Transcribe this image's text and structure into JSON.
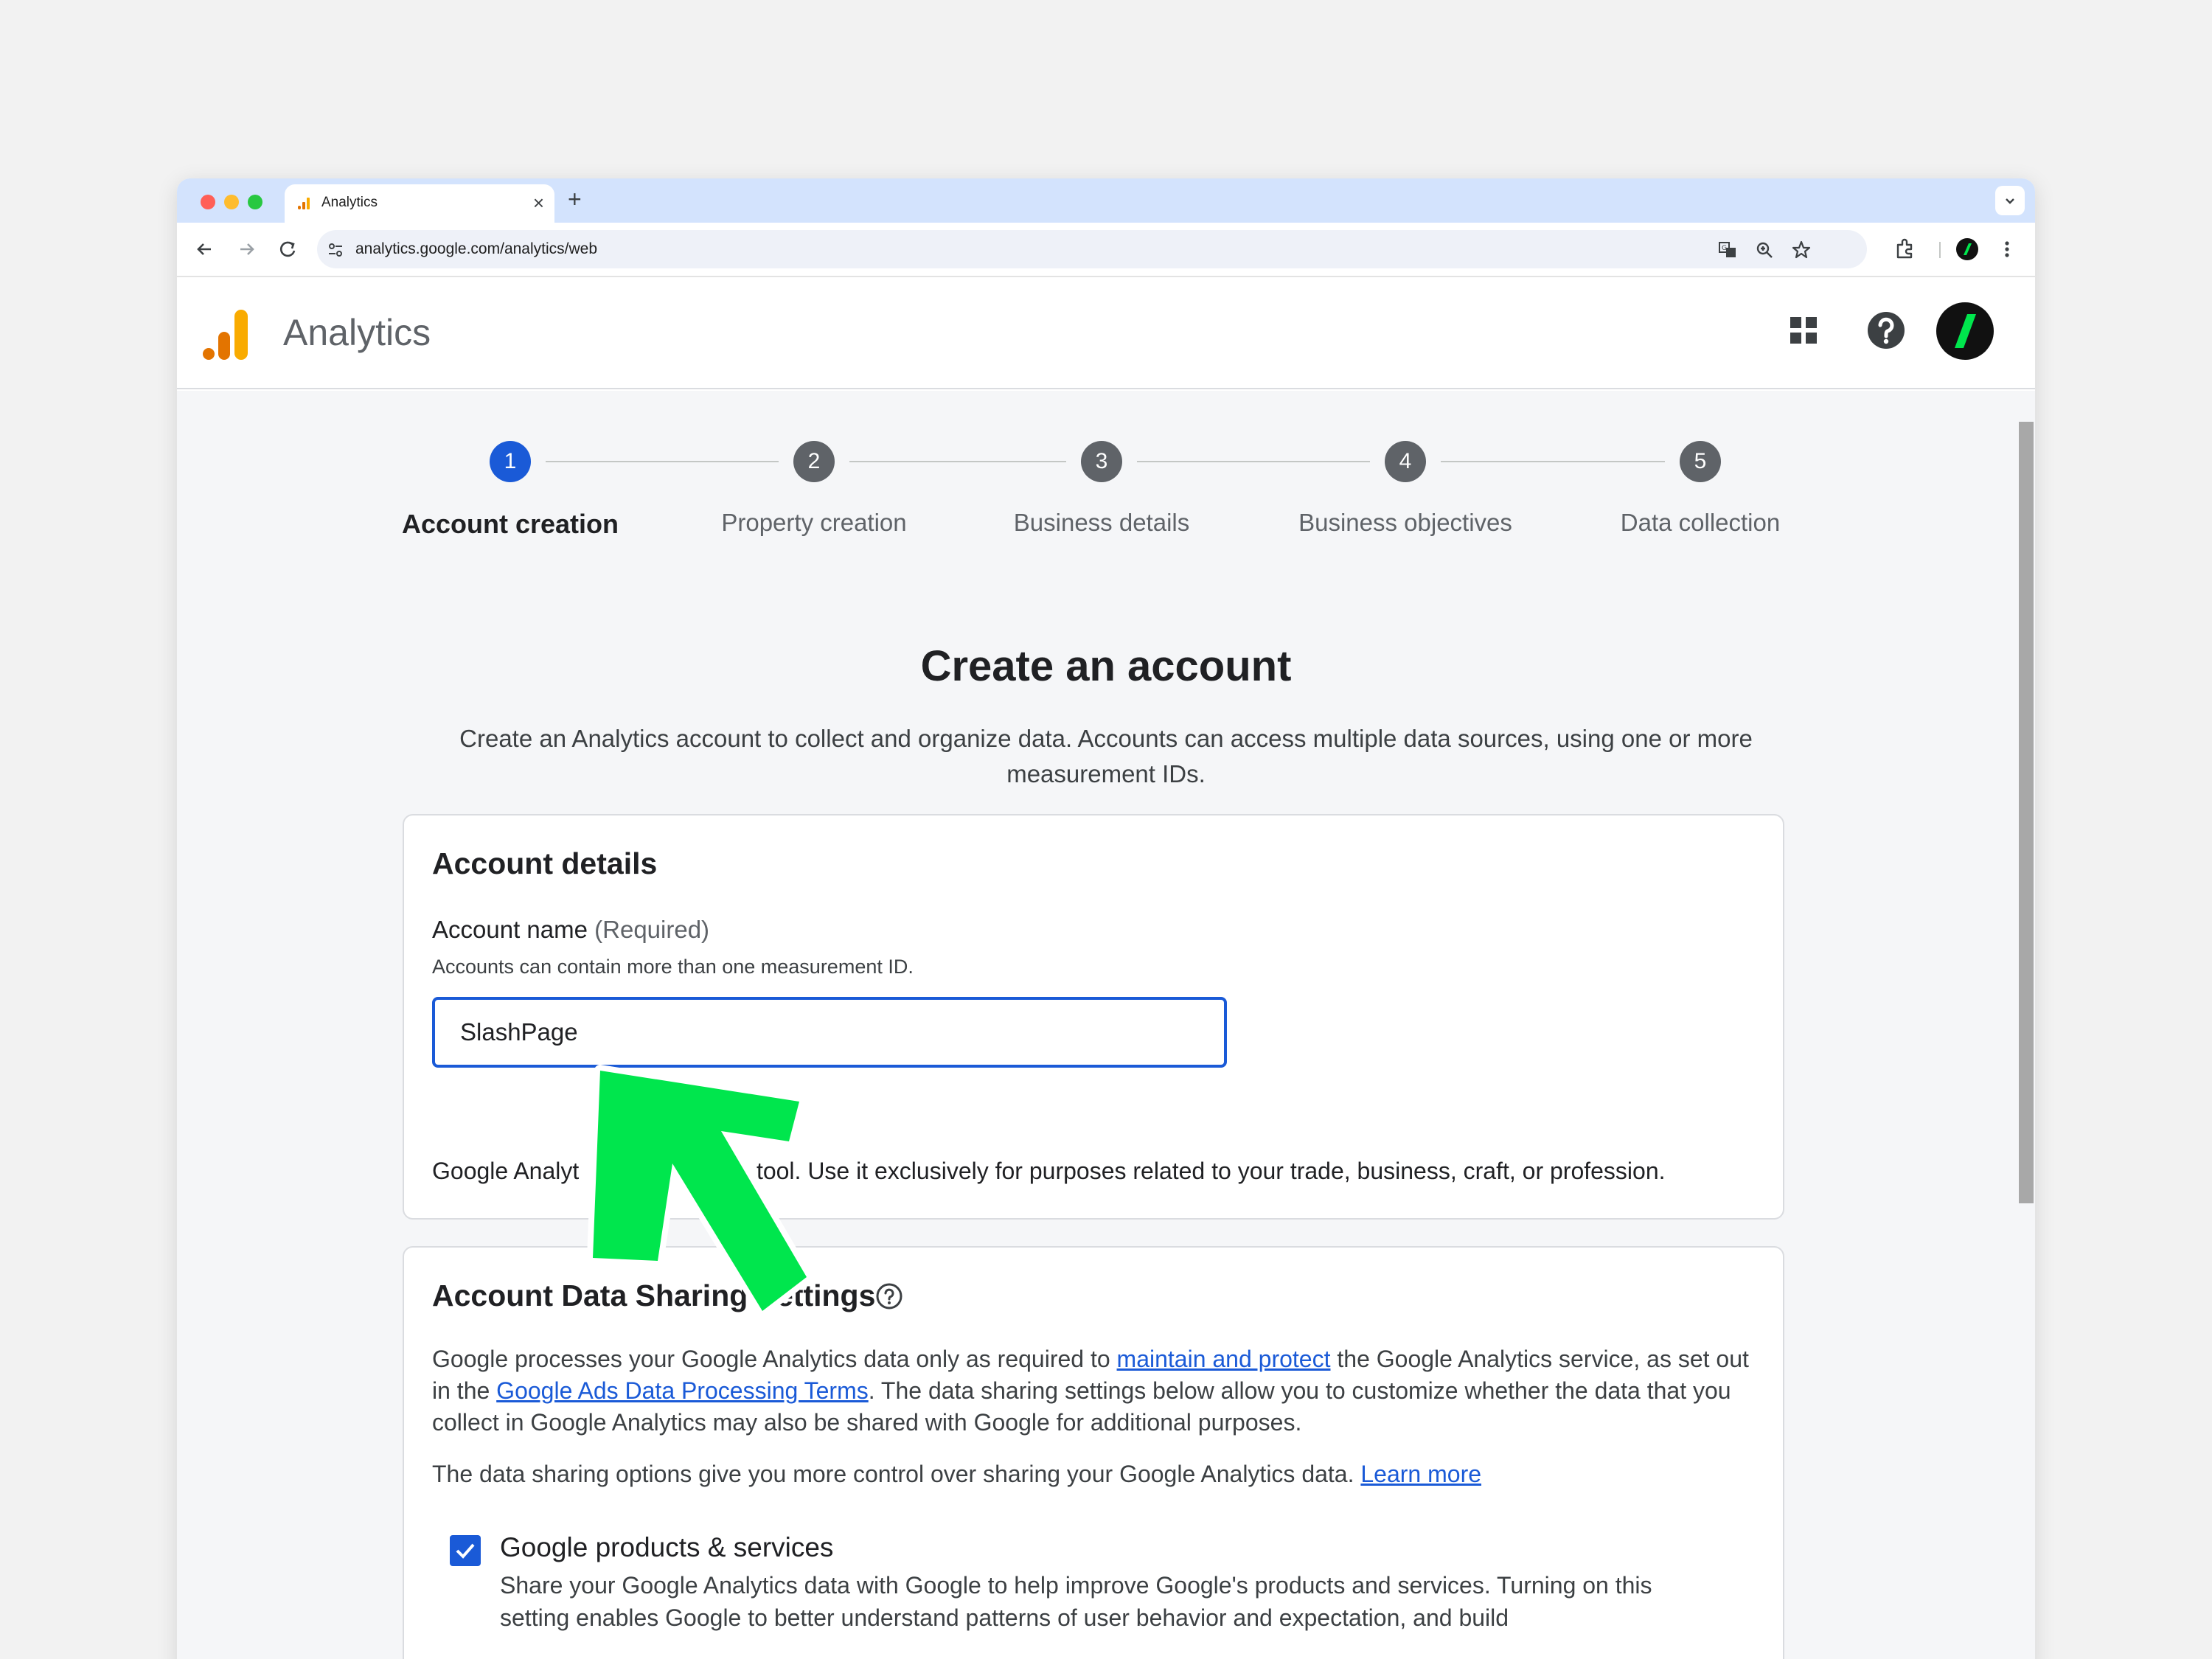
{
  "browser": {
    "tab_title": "Analytics",
    "tab_close": "×",
    "new_tab": "+",
    "url": "analytics.google.com/analytics/web"
  },
  "header": {
    "app_name": "Analytics"
  },
  "stepper": {
    "steps": [
      {
        "number": "1",
        "label": "Account creation",
        "active": true
      },
      {
        "number": "2",
        "label": "Property creation",
        "active": false
      },
      {
        "number": "3",
        "label": "Business details",
        "active": false
      },
      {
        "number": "4",
        "label": "Business objectives",
        "active": false
      },
      {
        "number": "5",
        "label": "Data collection",
        "active": false
      }
    ]
  },
  "main": {
    "title": "Create an account",
    "description": "Create an Analytics account to collect and organize data. Accounts can access multiple data sources, using one or more measurement IDs."
  },
  "account_details": {
    "title": "Account details",
    "field_label": "Account name",
    "field_required": "(Required)",
    "field_hint": "Accounts can contain more than one measurement ID.",
    "field_value": "SlashPage",
    "note": "Google Analyt",
    "note_mid": "a",
    "note_end": "s tool. Use it exclusively for purposes related to your trade, business, craft, or profession."
  },
  "data_sharing": {
    "title": "Account Data Sharing Settings",
    "para1_a": "Google processes your Google Analytics data only as required to ",
    "para1_link1": "maintain and protect",
    "para1_b": " the Google Analytics service, as set out in the ",
    "para1_link2": "Google Ads Data Processing Terms",
    "para1_c": ". The data sharing settings below allow you to customize whether the data that you collect in Google Analytics may also be shared with Google for additional purposes.",
    "para2": "The data sharing options give you more control over sharing your Google Analytics data. ",
    "para2_link": "Learn more",
    "option_title": "Google products & services",
    "option_desc": "Share your Google Analytics data with Google to help improve Google's products and services. Turning on this setting enables Google to better understand patterns of user behavior and expectation, and build",
    "option_checked": true
  },
  "colors": {
    "accent": "#1a5ad7",
    "arrow": "#00e64d"
  }
}
